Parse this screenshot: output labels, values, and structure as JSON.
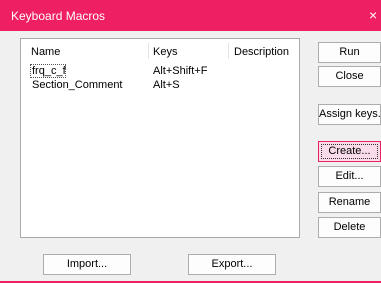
{
  "window": {
    "title": "Keyboard Macros",
    "close_glyph": "×"
  },
  "list": {
    "columns": [
      "Name",
      "Keys",
      "Description"
    ],
    "rows": [
      {
        "name": "frq_c_f",
        "keys": "Alt+Shift+F",
        "description": ""
      },
      {
        "name": "Section_Comment",
        "keys": "Alt+S",
        "description": ""
      }
    ]
  },
  "buttons": {
    "run": "Run",
    "close": "Close",
    "assign_keys": "Assign keys...",
    "create": "Create...",
    "edit": "Edit...",
    "rename": "Rename",
    "delete": "Delete",
    "import": "Import...",
    "export": "Export..."
  },
  "colors": {
    "accent": "#ee1f62",
    "focus_button_bg": "#f9dbea"
  }
}
